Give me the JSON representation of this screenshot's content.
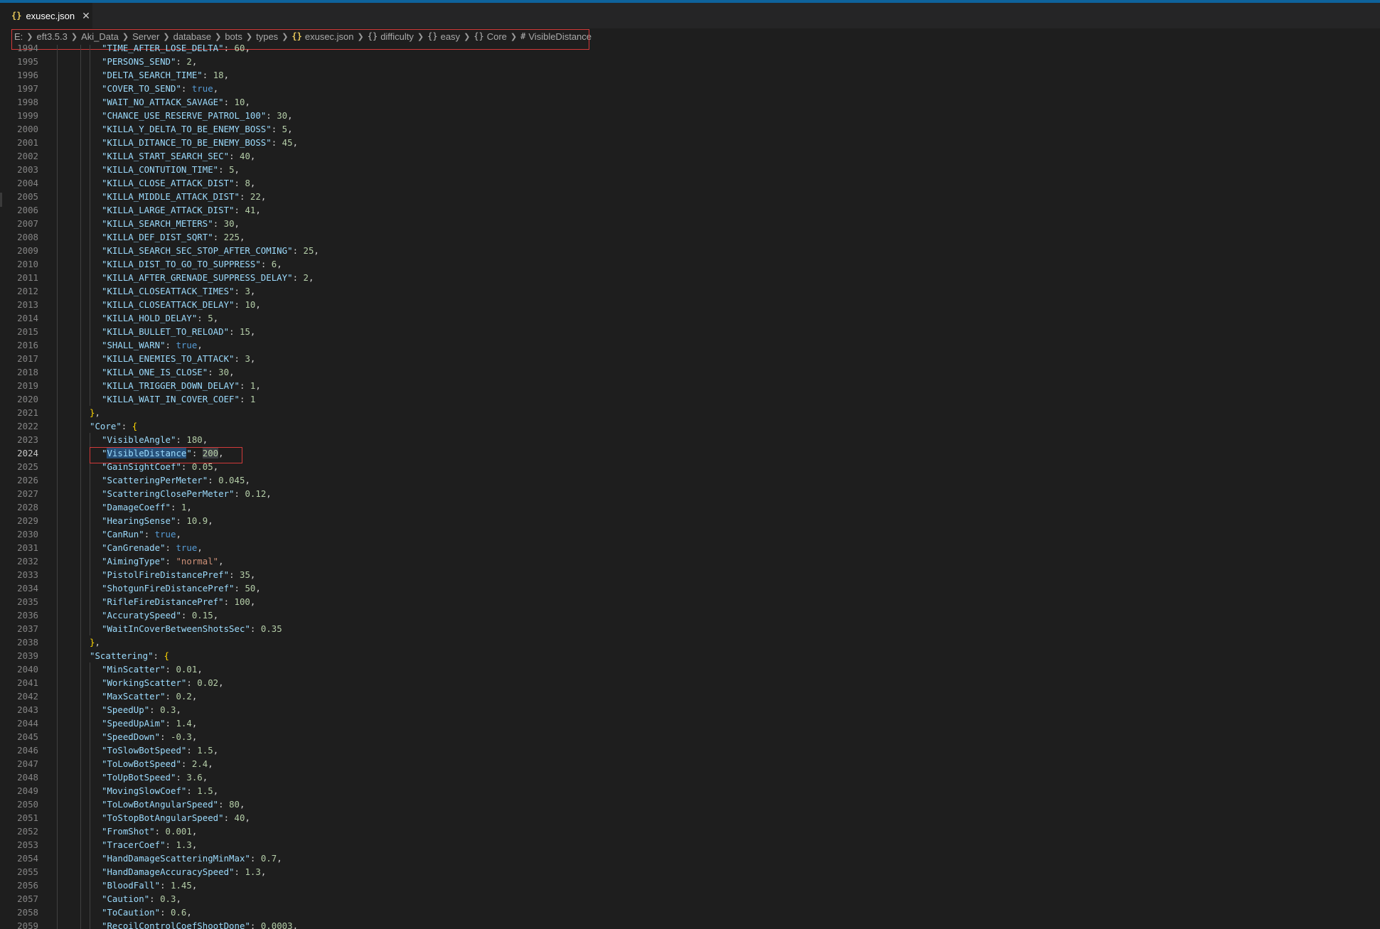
{
  "tab": {
    "icon": "{}",
    "title": "exusec.json",
    "close": "✕"
  },
  "breadcrumb": [
    {
      "icon": "",
      "label": "E:"
    },
    {
      "icon": "",
      "label": "eft3.5.3"
    },
    {
      "icon": "",
      "label": "Aki_Data"
    },
    {
      "icon": "",
      "label": "Server"
    },
    {
      "icon": "",
      "label": "database"
    },
    {
      "icon": "",
      "label": "bots"
    },
    {
      "icon": "",
      "label": "types"
    },
    {
      "icon": "{}",
      "label": "exusec.json"
    },
    {
      "icon": "{}",
      "label": "difficulty"
    },
    {
      "icon": "{}",
      "label": "easy"
    },
    {
      "icon": "{}",
      "label": "Core"
    },
    {
      "icon": "#",
      "label": "VisibleDistance"
    }
  ],
  "editor": {
    "active_line": 2024,
    "lines": [
      {
        "n": 1994,
        "d": 2,
        "k": "TIME_AFTER_LOSE_DELTA",
        "v": "60",
        "t": "n",
        "c": ","
      },
      {
        "n": 1995,
        "d": 2,
        "k": "PERSONS_SEND",
        "v": "2",
        "t": "n",
        "c": ","
      },
      {
        "n": 1996,
        "d": 2,
        "k": "DELTA_SEARCH_TIME",
        "v": "18",
        "t": "n",
        "c": ","
      },
      {
        "n": 1997,
        "d": 2,
        "k": "COVER_TO_SEND",
        "v": "true",
        "t": "b",
        "c": ","
      },
      {
        "n": 1998,
        "d": 2,
        "k": "WAIT_NO_ATTACK_SAVAGE",
        "v": "10",
        "t": "n",
        "c": ","
      },
      {
        "n": 1999,
        "d": 2,
        "k": "CHANCE_USE_RESERVE_PATROL_100",
        "v": "30",
        "t": "n",
        "c": ","
      },
      {
        "n": 2000,
        "d": 2,
        "k": "KILLA_Y_DELTA_TO_BE_ENEMY_BOSS",
        "v": "5",
        "t": "n",
        "c": ","
      },
      {
        "n": 2001,
        "d": 2,
        "k": "KILLA_DITANCE_TO_BE_ENEMY_BOSS",
        "v": "45",
        "t": "n",
        "c": ","
      },
      {
        "n": 2002,
        "d": 2,
        "k": "KILLA_START_SEARCH_SEC",
        "v": "40",
        "t": "n",
        "c": ","
      },
      {
        "n": 2003,
        "d": 2,
        "k": "KILLA_CONTUTION_TIME",
        "v": "5",
        "t": "n",
        "c": ","
      },
      {
        "n": 2004,
        "d": 2,
        "k": "KILLA_CLOSE_ATTACK_DIST",
        "v": "8",
        "t": "n",
        "c": ","
      },
      {
        "n": 2005,
        "d": 2,
        "k": "KILLA_MIDDLE_ATTACK_DIST",
        "v": "22",
        "t": "n",
        "c": ","
      },
      {
        "n": 2006,
        "d": 2,
        "k": "KILLA_LARGE_ATTACK_DIST",
        "v": "41",
        "t": "n",
        "c": ","
      },
      {
        "n": 2007,
        "d": 2,
        "k": "KILLA_SEARCH_METERS",
        "v": "30",
        "t": "n",
        "c": ","
      },
      {
        "n": 2008,
        "d": 2,
        "k": "KILLA_DEF_DIST_SQRT",
        "v": "225",
        "t": "n",
        "c": ","
      },
      {
        "n": 2009,
        "d": 2,
        "k": "KILLA_SEARCH_SEC_STOP_AFTER_COMING",
        "v": "25",
        "t": "n",
        "c": ","
      },
      {
        "n": 2010,
        "d": 2,
        "k": "KILLA_DIST_TO_GO_TO_SUPPRESS",
        "v": "6",
        "t": "n",
        "c": ","
      },
      {
        "n": 2011,
        "d": 2,
        "k": "KILLA_AFTER_GRENADE_SUPPRESS_DELAY",
        "v": "2",
        "t": "n",
        "c": ","
      },
      {
        "n": 2012,
        "d": 2,
        "k": "KILLA_CLOSEATTACK_TIMES",
        "v": "3",
        "t": "n",
        "c": ","
      },
      {
        "n": 2013,
        "d": 2,
        "k": "KILLA_CLOSEATTACK_DELAY",
        "v": "10",
        "t": "n",
        "c": ","
      },
      {
        "n": 2014,
        "d": 2,
        "k": "KILLA_HOLD_DELAY",
        "v": "5",
        "t": "n",
        "c": ","
      },
      {
        "n": 2015,
        "d": 2,
        "k": "KILLA_BULLET_TO_RELOAD",
        "v": "15",
        "t": "n",
        "c": ","
      },
      {
        "n": 2016,
        "d": 2,
        "k": "SHALL_WARN",
        "v": "true",
        "t": "b",
        "c": ","
      },
      {
        "n": 2017,
        "d": 2,
        "k": "KILLA_ENEMIES_TO_ATTACK",
        "v": "3",
        "t": "n",
        "c": ","
      },
      {
        "n": 2018,
        "d": 2,
        "k": "KILLA_ONE_IS_CLOSE",
        "v": "30",
        "t": "n",
        "c": ","
      },
      {
        "n": 2019,
        "d": 2,
        "k": "KILLA_TRIGGER_DOWN_DELAY",
        "v": "1",
        "t": "n",
        "c": ","
      },
      {
        "n": 2020,
        "d": 2,
        "k": "KILLA_WAIT_IN_COVER_COEF",
        "v": "1",
        "t": "n",
        "c": ""
      },
      {
        "n": 2021,
        "d": 1,
        "close": "}",
        "c": ","
      },
      {
        "n": 2022,
        "d": 1,
        "k": "Core",
        "open": "{"
      },
      {
        "n": 2023,
        "d": 2,
        "k": "VisibleAngle",
        "v": "180",
        "t": "n",
        "c": ","
      },
      {
        "n": 2024,
        "d": 2,
        "k": "VisibleDistance",
        "v": "200",
        "t": "n",
        "c": ",",
        "selected": true
      },
      {
        "n": 2025,
        "d": 2,
        "k": "GainSightCoef",
        "v": "0.05",
        "t": "n",
        "c": ","
      },
      {
        "n": 2026,
        "d": 2,
        "k": "ScatteringPerMeter",
        "v": "0.045",
        "t": "n",
        "c": ","
      },
      {
        "n": 2027,
        "d": 2,
        "k": "ScatteringClosePerMeter",
        "v": "0.12",
        "t": "n",
        "c": ","
      },
      {
        "n": 2028,
        "d": 2,
        "k": "DamageCoeff",
        "v": "1",
        "t": "n",
        "c": ","
      },
      {
        "n": 2029,
        "d": 2,
        "k": "HearingSense",
        "v": "10.9",
        "t": "n",
        "c": ","
      },
      {
        "n": 2030,
        "d": 2,
        "k": "CanRun",
        "v": "true",
        "t": "b",
        "c": ","
      },
      {
        "n": 2031,
        "d": 2,
        "k": "CanGrenade",
        "v": "true",
        "t": "b",
        "c": ","
      },
      {
        "n": 2032,
        "d": 2,
        "k": "AimingType",
        "v": "\"normal\"",
        "t": "s",
        "c": ","
      },
      {
        "n": 2033,
        "d": 2,
        "k": "PistolFireDistancePref",
        "v": "35",
        "t": "n",
        "c": ","
      },
      {
        "n": 2034,
        "d": 2,
        "k": "ShotgunFireDistancePref",
        "v": "50",
        "t": "n",
        "c": ","
      },
      {
        "n": 2035,
        "d": 2,
        "k": "RifleFireDistancePref",
        "v": "100",
        "t": "n",
        "c": ","
      },
      {
        "n": 2036,
        "d": 2,
        "k": "AccuratySpeed",
        "v": "0.15",
        "t": "n",
        "c": ","
      },
      {
        "n": 2037,
        "d": 2,
        "k": "WaitInCoverBetweenShotsSec",
        "v": "0.35",
        "t": "n",
        "c": ""
      },
      {
        "n": 2038,
        "d": 1,
        "close": "}",
        "c": ","
      },
      {
        "n": 2039,
        "d": 1,
        "k": "Scattering",
        "open": "{"
      },
      {
        "n": 2040,
        "d": 2,
        "k": "MinScatter",
        "v": "0.01",
        "t": "n",
        "c": ","
      },
      {
        "n": 2041,
        "d": 2,
        "k": "WorkingScatter",
        "v": "0.02",
        "t": "n",
        "c": ","
      },
      {
        "n": 2042,
        "d": 2,
        "k": "MaxScatter",
        "v": "0.2",
        "t": "n",
        "c": ","
      },
      {
        "n": 2043,
        "d": 2,
        "k": "SpeedUp",
        "v": "0.3",
        "t": "n",
        "c": ","
      },
      {
        "n": 2044,
        "d": 2,
        "k": "SpeedUpAim",
        "v": "1.4",
        "t": "n",
        "c": ","
      },
      {
        "n": 2045,
        "d": 2,
        "k": "SpeedDown",
        "v": "-0.3",
        "t": "n",
        "c": ","
      },
      {
        "n": 2046,
        "d": 2,
        "k": "ToSlowBotSpeed",
        "v": "1.5",
        "t": "n",
        "c": ","
      },
      {
        "n": 2047,
        "d": 2,
        "k": "ToLowBotSpeed",
        "v": "2.4",
        "t": "n",
        "c": ","
      },
      {
        "n": 2048,
        "d": 2,
        "k": "ToUpBotSpeed",
        "v": "3.6",
        "t": "n",
        "c": ","
      },
      {
        "n": 2049,
        "d": 2,
        "k": "MovingSlowCoef",
        "v": "1.5",
        "t": "n",
        "c": ","
      },
      {
        "n": 2050,
        "d": 2,
        "k": "ToLowBotAngularSpeed",
        "v": "80",
        "t": "n",
        "c": ","
      },
      {
        "n": 2051,
        "d": 2,
        "k": "ToStopBotAngularSpeed",
        "v": "40",
        "t": "n",
        "c": ","
      },
      {
        "n": 2052,
        "d": 2,
        "k": "FromShot",
        "v": "0.001",
        "t": "n",
        "c": ","
      },
      {
        "n": 2053,
        "d": 2,
        "k": "TracerCoef",
        "v": "1.3",
        "t": "n",
        "c": ","
      },
      {
        "n": 2054,
        "d": 2,
        "k": "HandDamageScatteringMinMax",
        "v": "0.7",
        "t": "n",
        "c": ","
      },
      {
        "n": 2055,
        "d": 2,
        "k": "HandDamageAccuracySpeed",
        "v": "1.3",
        "t": "n",
        "c": ","
      },
      {
        "n": 2056,
        "d": 2,
        "k": "BloodFall",
        "v": "1.45",
        "t": "n",
        "c": ","
      },
      {
        "n": 2057,
        "d": 2,
        "k": "Caution",
        "v": "0.3",
        "t": "n",
        "c": ","
      },
      {
        "n": 2058,
        "d": 2,
        "k": "ToCaution",
        "v": "0.6",
        "t": "n",
        "c": ","
      },
      {
        "n": 2059,
        "d": 2,
        "k": "RecoilControlCoefShootDone",
        "v": "0.0003",
        "t": "n",
        "c": ","
      }
    ]
  }
}
